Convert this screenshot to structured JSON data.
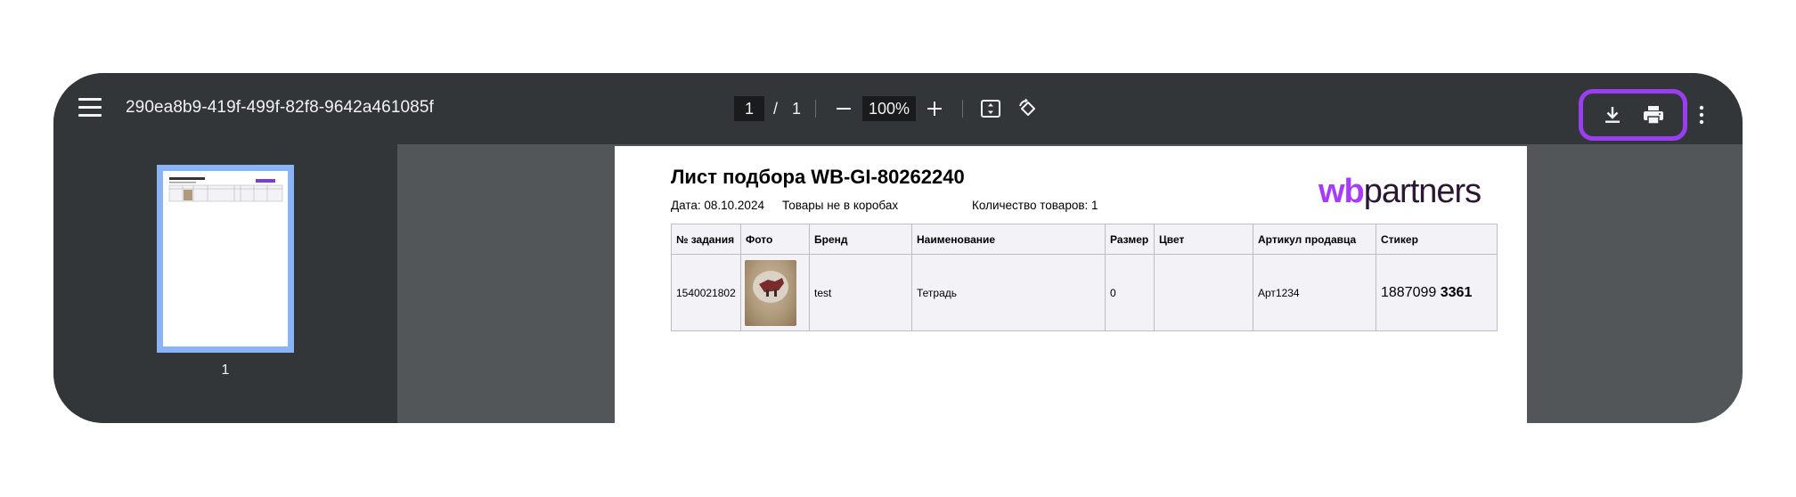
{
  "toolbar": {
    "doc_title": "290ea8b9-419f-499f-82f8-9642a461085f",
    "current_page": "1",
    "page_separator": "/",
    "total_pages": "1",
    "zoom": "100%"
  },
  "sidebar": {
    "thumbnail_page_number": "1"
  },
  "document": {
    "heading": "Лист подбора WB-GI-80262240",
    "date": "Дата: 08.10.2024",
    "boxes": "Товары не в коробах",
    "quantity": "Количество товаров: 1",
    "logo_wb": "wb",
    "logo_partners": "partners",
    "table": {
      "headers": [
        "№ задания",
        "Фото",
        "Бренд",
        "Наименование",
        "Размер",
        "Цвет",
        "Артикул продавца",
        "Стикер"
      ],
      "row": {
        "task_no": "1540021802",
        "brand": "test",
        "name": "Тетрадь",
        "size": "0",
        "color": "",
        "seller_sku": "Арт1234",
        "sticker_part1": "1887099",
        "sticker_part2": "3361"
      }
    }
  },
  "colors": {
    "highlight": "#9b3df0",
    "toolbar_bg": "#323639",
    "viewer_bg": "#525659",
    "thumb_border": "#8ab4f8",
    "logo_wb": "#a73afd"
  },
  "icons": [
    "menu-icon",
    "zoom-out-icon",
    "zoom-in-icon",
    "fit-page-icon",
    "rotate-icon",
    "download-icon",
    "print-icon",
    "more-vert-icon"
  ]
}
